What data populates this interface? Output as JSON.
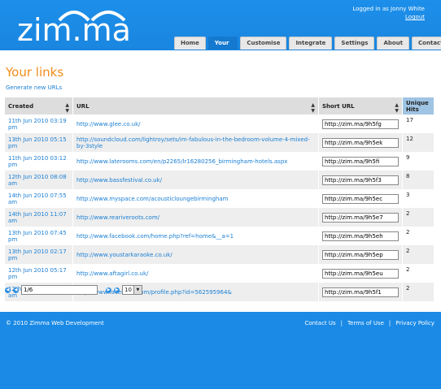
{
  "brand": {
    "logo_text": "zim.ma"
  },
  "user": {
    "logged_in_text": "Logged in as Jonny White",
    "logout_label": "Logout"
  },
  "nav": {
    "tabs": [
      "Home",
      "Your Links",
      "Customise",
      "Integrate",
      "Settings",
      "About us",
      "Contact"
    ],
    "active": "Your Links"
  },
  "page": {
    "title": "Your links",
    "generate_label": "Generate new URLs"
  },
  "table": {
    "headers": {
      "created": "Created",
      "url": "URL",
      "short": "Short URL",
      "hits_1": "Unique",
      "hits_2": "Hits"
    },
    "rows": [
      {
        "created": "11th Jun 2010 03:19 pm",
        "url": "http://www.glee.co.uk/",
        "short": "http://zim.ma/9h5fg",
        "hits": "17"
      },
      {
        "created": "13th Jun 2010 05:15 pm",
        "url": "http://soundcloud.com/lightroy/sets/im-fabulous-in-the-bedroom-volume-4-mixed-by-3style",
        "short": "http://zim.ma/9h5ek",
        "hits": "12"
      },
      {
        "created": "11th Jun 2010 03:12 pm",
        "url": "http://www.laterooms.com/en/p2265/lr16280256_birmingham-hotels.aspx",
        "short": "http://zim.ma/9h5fi",
        "hits": "9"
      },
      {
        "created": "12th Jun 2010 08:08 am",
        "url": "http://www.bassfestival.co.uk/",
        "short": "http://zim.ma/9h5f3",
        "hits": "8"
      },
      {
        "created": "14th Jun 2010 07:55 am",
        "url": "http://www.myspace.com/acousticloungebirmingham",
        "short": "http://zim.ma/9h5ec",
        "hits": "3"
      },
      {
        "created": "14th Jun 2010 11:07 am",
        "url": "http://www.reariveroots.com/",
        "short": "http://zim.ma/9h5e7",
        "hits": "2"
      },
      {
        "created": "13th Jun 2010 07:45 pm",
        "url": "http://www.facebook.com/home.php?ref=home&__a=1",
        "short": "http://zim.ma/9h5eh",
        "hits": "2"
      },
      {
        "created": "13th Jun 2010 02:17 pm",
        "url": "http://www.youstarkaraoke.co.uk/",
        "short": "http://zim.ma/9h5ep",
        "hits": "2"
      },
      {
        "created": "12th Jun 2010 05:17 pm",
        "url": "http://www.aftagirl.co.uk/",
        "short": "http://zim.ma/9h5eu",
        "hits": "2"
      },
      {
        "created": "12th Jun 2010 11:11 am",
        "url": "http://www.facebook.com/profile.php?id=562595964&",
        "short": "http://zim.ma/9h5f1",
        "hits": "2"
      }
    ]
  },
  "pager": {
    "page_value": "1/6",
    "page_size": "10"
  },
  "footer": {
    "copyright": "© 2010 Zimma Web Development",
    "links": [
      "Contact Us",
      "Terms of Use",
      "Privacy Policy"
    ],
    "separator": "|"
  },
  "colors": {
    "brand_blue": "#1a8ae6",
    "title_orange": "#f28c1c",
    "link_blue": "#1a7fd4"
  }
}
